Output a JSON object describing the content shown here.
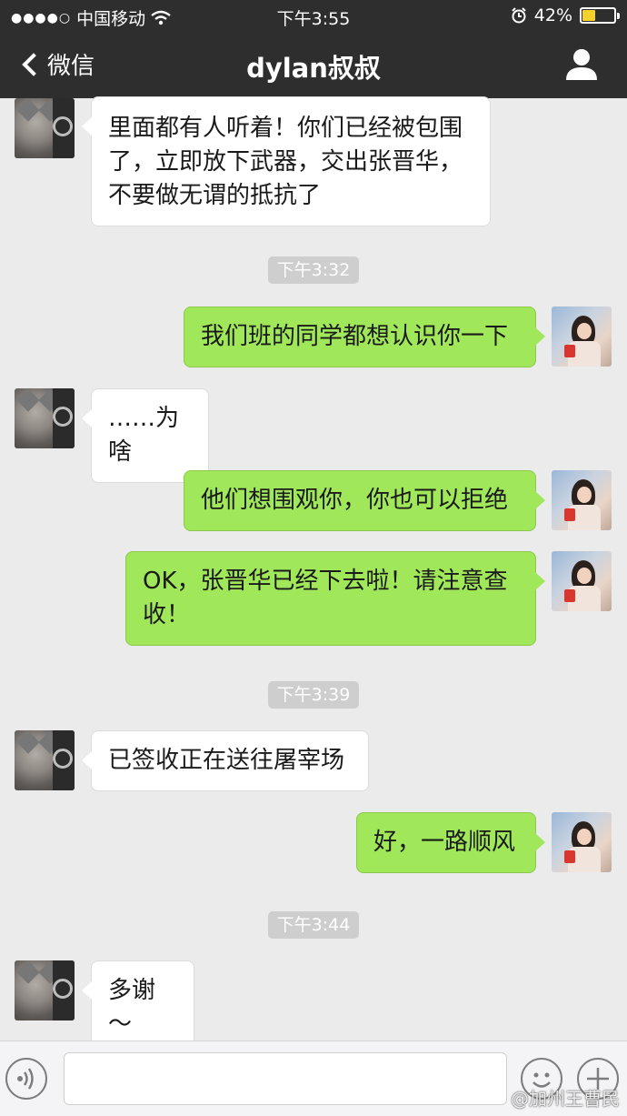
{
  "status": {
    "signal": "●●●●○",
    "carrier": "中国移动",
    "time": "下午3:55",
    "battery": "42%",
    "battery_level": 0.42
  },
  "nav": {
    "back_label": "微信",
    "title": "dylan叔叔"
  },
  "messages": {
    "m1": "里面都有人听着！你们已经被包围了，立即放下武器，交出张晋华，不要做无谓的抵抗了",
    "t1": "下午3:32",
    "m2": "我们班的同学都想认识你一下",
    "m3": "……为啥",
    "m4": "他们想围观你，你也可以拒绝",
    "m5": "OK，张晋华已经下去啦！请注意查收！",
    "t2": "下午3:39",
    "m6": "已签收正在送往屠宰场",
    "m7": "好，一路顺风",
    "t3": "下午3:44",
    "m8": "多谢～"
  },
  "input": {
    "value": "",
    "placeholder": ""
  },
  "watermark": "@加州王曹民",
  "icons": [
    "back-chevron-icon",
    "profile-icon",
    "wifi-icon",
    "alarm-icon",
    "voice-icon",
    "emoji-icon",
    "plus-icon"
  ],
  "colors": {
    "nav_bg": "#2e2e2e",
    "chat_bg": "#ebebeb",
    "outgoing_bubble": "#a0e75a",
    "incoming_bubble": "#ffffff",
    "timestamp_bg": "#cecece"
  }
}
